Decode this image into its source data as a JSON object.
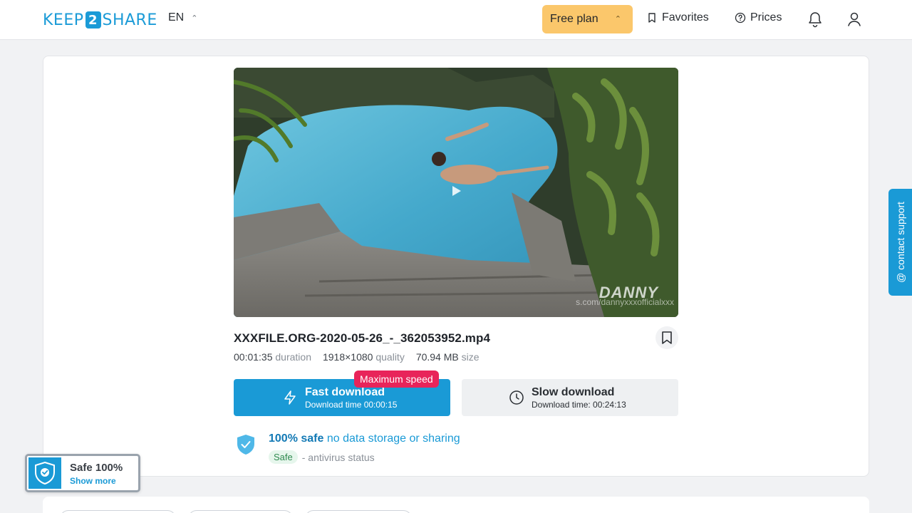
{
  "header": {
    "logo_left": "KEEP",
    "logo_mid": "2",
    "logo_right": "SHARE",
    "language": "EN",
    "plan_label": "Free plan",
    "favorites_label": "Favorites",
    "prices_label": "Prices"
  },
  "video": {
    "watermark": "DANNY",
    "watermark_url": "s.com/dannyxxxofficialxxx"
  },
  "file": {
    "name": "XXXFILE.ORG-2020-05-26_-_362053952.mp4",
    "duration_value": "00:01:35",
    "duration_label": "duration",
    "quality_value": "1918×1080",
    "quality_label": "quality",
    "size_value": "70.94 MB",
    "size_label": "size"
  },
  "downloads": {
    "fast_title": "Fast download",
    "fast_sub": "Download time 00:00:15",
    "max_badge": "Maximum speed",
    "slow_title": "Slow download",
    "slow_sub": "Download time: 00:24:13"
  },
  "safety": {
    "bold": "100% safe",
    "rest": "no data storage or sharing",
    "badge": "Safe",
    "status": "- antivirus status"
  },
  "widget": {
    "title": "Safe 100%",
    "link": "Show more"
  },
  "support": {
    "label": "@ contact support"
  },
  "colors": {
    "accent": "#1a9ad6",
    "plan": "#fbc76b",
    "badge_red": "#e8245a"
  }
}
